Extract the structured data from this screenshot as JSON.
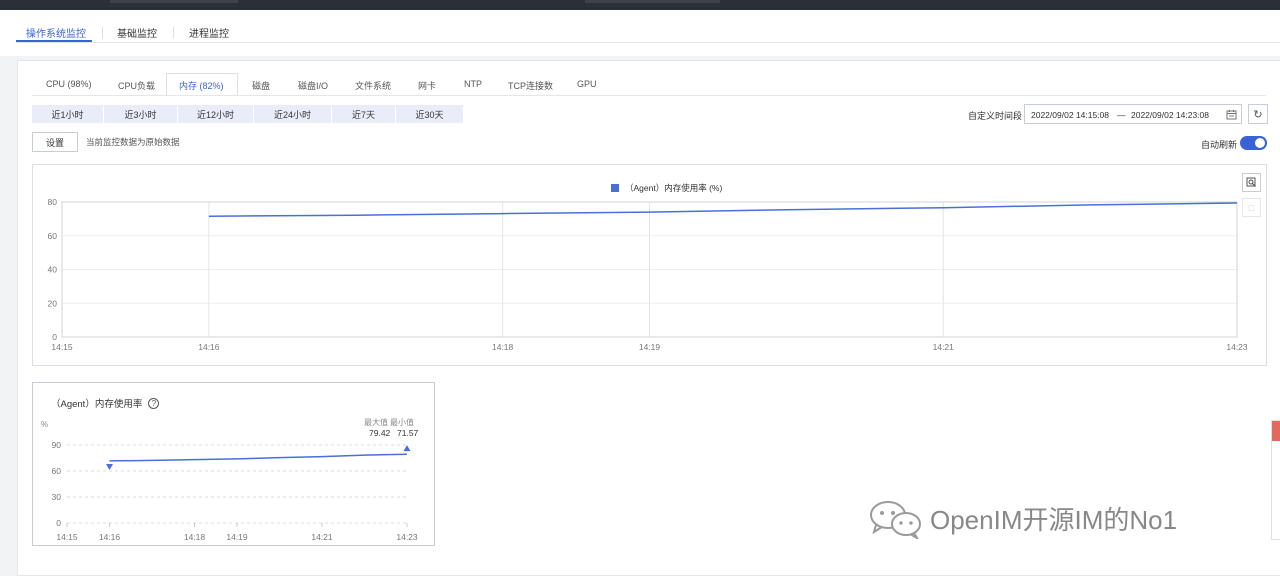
{
  "main_tabs": [
    {
      "label": "操作系统监控",
      "active": true
    },
    {
      "label": "基础监控",
      "active": false
    },
    {
      "label": "进程监控",
      "active": false
    }
  ],
  "sub_tabs": [
    {
      "label": "CPU (98%)",
      "active": false
    },
    {
      "label": "CPU负载",
      "active": false
    },
    {
      "label": "内存 (82%)",
      "active": true
    },
    {
      "label": "磁盘",
      "active": false
    },
    {
      "label": "磁盘I/O",
      "active": false
    },
    {
      "label": "文件系统",
      "active": false
    },
    {
      "label": "网卡",
      "active": false
    },
    {
      "label": "NTP",
      "active": false
    },
    {
      "label": "TCP连接数",
      "active": false
    },
    {
      "label": "GPU",
      "active": false
    }
  ],
  "time_ranges": [
    "近1小时",
    "近3小时",
    "近12小时",
    "近24小时",
    "近7天",
    "近30天"
  ],
  "custom_range": {
    "label": "自定义时间段",
    "start": "2022/09/02 14:15:08",
    "separator": "—",
    "end": "2022/09/02 14:23:08"
  },
  "settings_label": "设置",
  "data_note": "当前监控数据为原始数据",
  "auto_refresh": {
    "label": "自动刷新",
    "on": true
  },
  "colors": {
    "accent": "#3a62d7",
    "series": "#4a6fd8"
  },
  "chart_data": [
    {
      "type": "line",
      "title": "",
      "series": [
        {
          "name": "（Agent）内存使用率 (%)",
          "x": [
            "14:16",
            "14:17",
            "14:18",
            "14:19",
            "14:20",
            "14:21",
            "14:22",
            "14:23"
          ],
          "values": [
            71.6,
            72.2,
            73.1,
            74.0,
            75.5,
            76.6,
            78.3,
            79.4
          ]
        }
      ],
      "x_ticks": [
        "14:15",
        "14:16",
        "14:18",
        "14:19",
        "14:21",
        "14:23"
      ],
      "ylim": [
        0,
        80
      ],
      "y_ticks": [
        0,
        20,
        40,
        60,
        80
      ],
      "grid": true,
      "legend": "top-center"
    },
    {
      "type": "line",
      "title": "（Agent）内存使用率",
      "unit": "%",
      "series": [
        {
          "name": "",
          "x": [
            "14:16",
            "14:17",
            "14:18",
            "14:19",
            "14:20",
            "14:21",
            "14:22",
            "14:23"
          ],
          "values": [
            71.6,
            72.2,
            73.1,
            74.0,
            75.5,
            76.6,
            78.3,
            79.4
          ]
        }
      ],
      "x_ticks": [
        "14:15",
        "14:16",
        "14:18",
        "14:19",
        "14:21",
        "14:23"
      ],
      "ylim": [
        0,
        90
      ],
      "y_ticks": [
        0,
        30,
        60,
        90
      ],
      "max": {
        "label": "最大值",
        "value": "79.42"
      },
      "min": {
        "label": "最小值",
        "value": "71.57"
      },
      "grid": true
    }
  ],
  "watermark": "OpenIM开源IM的No1"
}
